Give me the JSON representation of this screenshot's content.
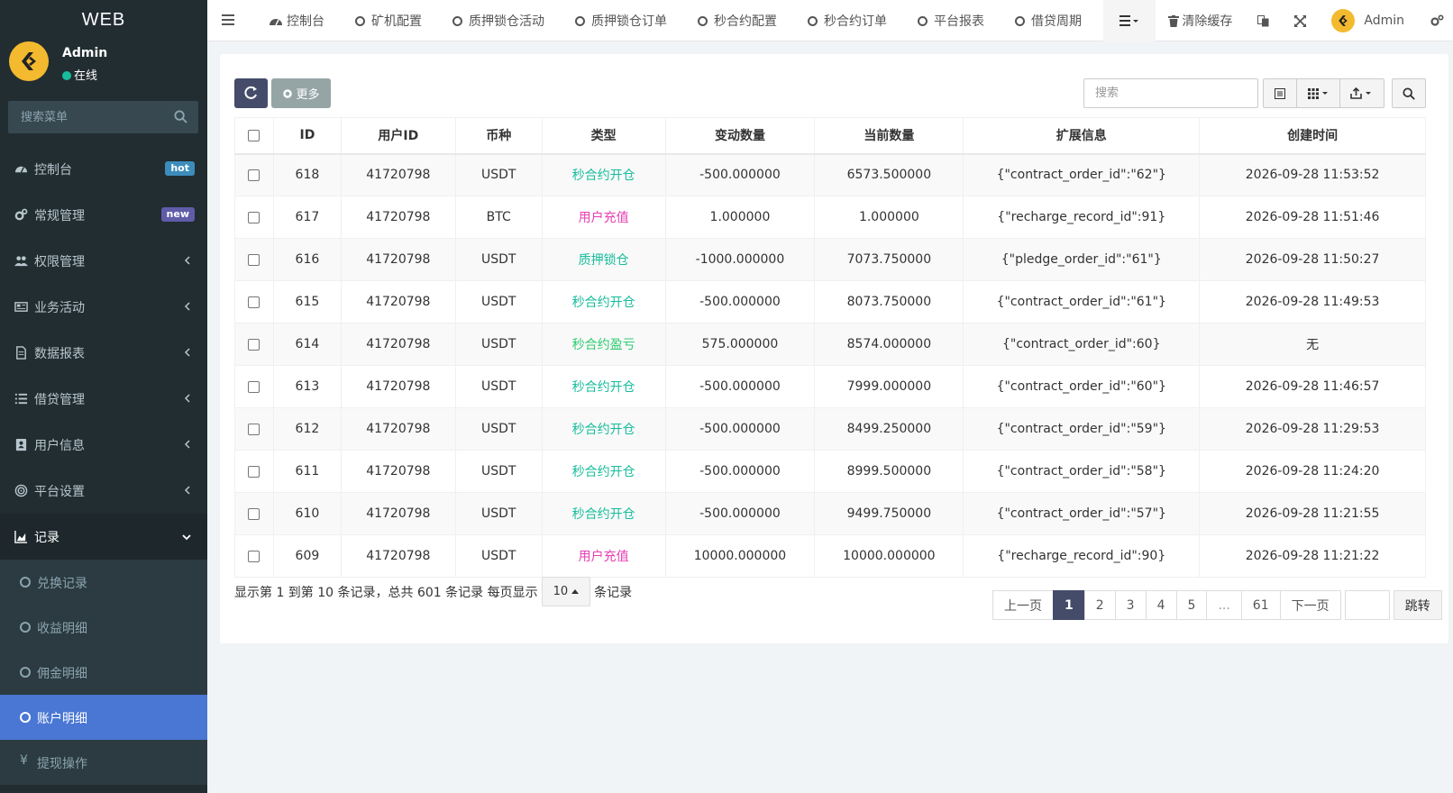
{
  "sidebar": {
    "brand": "WEB",
    "user": {
      "name": "Admin",
      "status": "在线"
    },
    "search_placeholder": "搜索菜单",
    "items": [
      {
        "label": "控制台",
        "badge": "hot"
      },
      {
        "label": "常规管理",
        "badge": "new"
      },
      {
        "label": "权限管理"
      },
      {
        "label": "业务活动"
      },
      {
        "label": "数据报表"
      },
      {
        "label": "借贷管理"
      },
      {
        "label": "用户信息"
      },
      {
        "label": "平台设置"
      },
      {
        "label": "记录"
      }
    ],
    "sub_items": [
      {
        "label": "兑换记录"
      },
      {
        "label": "收益明细"
      },
      {
        "label": "佣金明细"
      },
      {
        "label": "账户明细"
      },
      {
        "label": "提现操作"
      }
    ]
  },
  "topnav": {
    "tabs": [
      "控制台",
      "矿机配置",
      "质押锁仓活动",
      "质押锁仓订单",
      "秒合约配置",
      "秒合约订单",
      "平台报表",
      "借贷周期"
    ],
    "clear_cache": "清除缓存",
    "admin": "Admin"
  },
  "toolbar": {
    "more_label": "更多",
    "search_placeholder": "搜索"
  },
  "table": {
    "headers": [
      "ID",
      "用户ID",
      "币种",
      "类型",
      "变动数量",
      "当前数量",
      "扩展信息",
      "创建时间"
    ],
    "rows": [
      [
        "618",
        "41720798",
        "USDT",
        "秒合约开仓",
        "-500.000000",
        "6573.500000",
        "{\"contract_order_id\":\"62\"}",
        "2026-09-28 11:53:52"
      ],
      [
        "617",
        "41720798",
        "BTC",
        "用户充值",
        "1.000000",
        "1.000000",
        "{\"recharge_record_id\":91}",
        "2026-09-28 11:51:46"
      ],
      [
        "616",
        "41720798",
        "USDT",
        "质押锁仓",
        "-1000.000000",
        "7073.750000",
        "{\"pledge_order_id\":\"61\"}",
        "2026-09-28 11:50:27"
      ],
      [
        "615",
        "41720798",
        "USDT",
        "秒合约开仓",
        "-500.000000",
        "8073.750000",
        "{\"contract_order_id\":\"61\"}",
        "2026-09-28 11:49:53"
      ],
      [
        "614",
        "41720798",
        "USDT",
        "秒合约盈亏",
        "575.000000",
        "8574.000000",
        "{\"contract_order_id\":60}",
        "无"
      ],
      [
        "613",
        "41720798",
        "USDT",
        "秒合约开仓",
        "-500.000000",
        "7999.000000",
        "{\"contract_order_id\":\"60\"}",
        "2026-09-28 11:46:57"
      ],
      [
        "612",
        "41720798",
        "USDT",
        "秒合约开仓",
        "-500.000000",
        "8499.250000",
        "{\"contract_order_id\":\"59\"}",
        "2026-09-28 11:29:53"
      ],
      [
        "611",
        "41720798",
        "USDT",
        "秒合约开仓",
        "-500.000000",
        "8999.500000",
        "{\"contract_order_id\":\"58\"}",
        "2026-09-28 11:24:20"
      ],
      [
        "610",
        "41720798",
        "USDT",
        "秒合约开仓",
        "-500.000000",
        "9499.750000",
        "{\"contract_order_id\":\"57\"}",
        "2026-09-28 11:21:55"
      ],
      [
        "609",
        "41720798",
        "USDT",
        "用户充值",
        "10000.000000",
        "10000.000000",
        "{\"recharge_record_id\":90}",
        "2026-09-28 11:21:22"
      ]
    ]
  },
  "type_colors": {
    "秒合约开仓": "#18bc9c",
    "用户充值": "#e83eb3",
    "质押锁仓": "#18bc9c",
    "秒合约盈亏": "#2ecc71"
  },
  "footer": {
    "info_prefix": "显示第 1 到第 10 条记录，总共 601 条记录 每页显示",
    "page_size": "10",
    "info_suffix": "条记录",
    "prev": "上一页",
    "pages": [
      "1",
      "2",
      "3",
      "4",
      "5",
      "...",
      "61"
    ],
    "current_page": "1",
    "next": "下一页",
    "jump": "跳转"
  },
  "colors": {
    "sidebar_bg": "#222d32",
    "active_item": "#4a77d4",
    "primary_btn": "#444c69"
  }
}
